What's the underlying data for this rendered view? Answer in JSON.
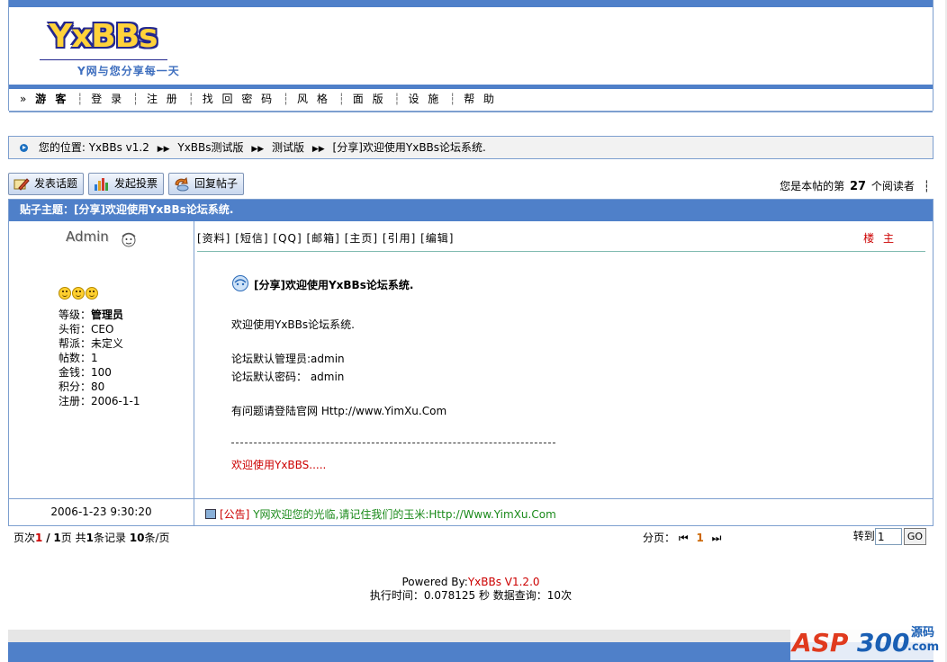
{
  "header": {
    "logo_text": "YxBBs",
    "slogan": "Y网与您分享每一天",
    "nav": {
      "prefix": "»",
      "guest": "游 客",
      "items": [
        "登 录",
        "注 册",
        "找 回 密 码",
        "风 格",
        "面 版",
        "设 施",
        "帮 助"
      ]
    }
  },
  "breadcrumb": {
    "label": "您的位置:",
    "items": [
      "YxBBs v1.2",
      "YxBBs测试版",
      "测试版",
      "[分享]欢迎使用YxBBs论坛系统."
    ]
  },
  "actions": {
    "new_topic": "发表话题",
    "new_poll": "发起投票",
    "reply": "回复帖子"
  },
  "reader": {
    "prefix": "您是本帖的第",
    "count": "27",
    "suffix": "个阅读者",
    "end": "┆"
  },
  "topic": {
    "header": "贴子主题：[分享]欢迎使用YxBBs论坛系统."
  },
  "post": {
    "user": {
      "name": "Admin",
      "fields": [
        {
          "label": "等级：",
          "value": "管理员"
        },
        {
          "label": "头衔：",
          "value": "CEO"
        },
        {
          "label": "帮派：",
          "value": "未定义"
        },
        {
          "label": "帖数：",
          "value": "1"
        },
        {
          "label": "金钱：",
          "value": "100"
        },
        {
          "label": "积分：",
          "value": "80"
        },
        {
          "label": "注册：",
          "value": "2006-1-1"
        }
      ]
    },
    "tools": [
      "[资料]",
      "[短信]",
      "[QQ]",
      "[邮箱]",
      "[主页]",
      "[引用]",
      "[编辑]"
    ],
    "floor": "楼 主",
    "title": "[分享]欢迎使用YxBBs论坛系统.",
    "lines": [
      "欢迎使用YxBBs论坛系统.",
      "论坛默认管理员:admin",
      "论坛默认密码： admin",
      "有问题请登陆官网 Http://www.YimXu.Com"
    ],
    "signature": "欢迎使用YxBBS.....",
    "time": "2006-1-23 9:30:20",
    "notice_tag": "[公告]",
    "notice_text": "Y网欢迎您的光临,请记住我们的玉米:Http://Www.YimXu.Com"
  },
  "paging": {
    "p1": "页次",
    "current": "1",
    "slash": "/",
    "total": "1",
    "p2": "页 共",
    "records": "1",
    "p3": "条记录",
    "per_page": "10",
    "p4": "条/页",
    "pages_label": "分页：",
    "page_current": "1",
    "first_icon": "⏮",
    "last_icon": "⏭",
    "jump_label": "转到",
    "jump_value": "1",
    "go_label": "GO"
  },
  "footer": {
    "powered_prefix": "Powered By:",
    "powered_name": "YxBBs V1.2.0",
    "exec": "执行时间：0.078125 秒 数据查询：10次"
  },
  "watermark": {
    "a": "ASP",
    "b": "300",
    "c": "源码",
    "d": ".com"
  },
  "colors": {
    "accent": "#4f80c9",
    "border": "#7d9fcf",
    "red": "#cc0000",
    "green": "#1a8a1a"
  }
}
